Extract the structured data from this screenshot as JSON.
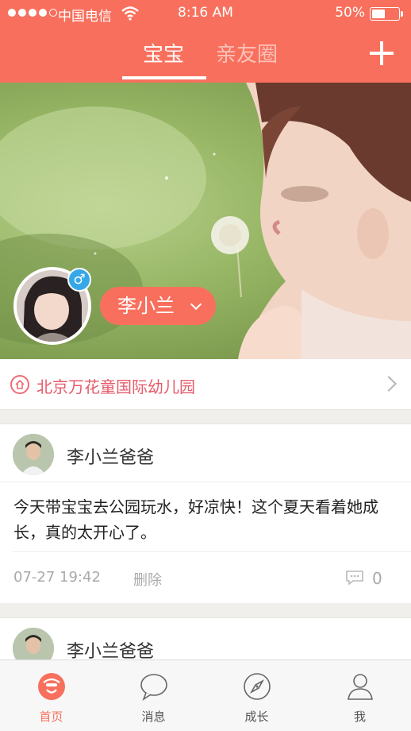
{
  "status_bar": {
    "carrier": "中国电信",
    "time": "8:16 AM",
    "battery": "50%",
    "battery_level": 0.5
  },
  "header": {
    "tabs": [
      {
        "label": "宝宝",
        "active": true
      },
      {
        "label": "亲友圈",
        "active": false
      }
    ],
    "add_icon": "plus-icon"
  },
  "profile": {
    "gender_symbol": "♂",
    "name": "李小兰",
    "school": "北京万花童国际幼儿园"
  },
  "posts": [
    {
      "author": "李小兰爸爸",
      "text": "今天带宝宝去公园玩水，好凉快！这个夏天看着她成长，真的太开心了。",
      "time": "07-27 19:42",
      "delete_label": "删除",
      "comment_count": "0"
    },
    {
      "author": "李小兰爸爸"
    }
  ],
  "tabbar": [
    {
      "label": "首页",
      "icon": "home-face-icon",
      "active": true
    },
    {
      "label": "消息",
      "icon": "message-bubble-icon",
      "active": false
    },
    {
      "label": "成长",
      "icon": "compass-icon",
      "active": false
    },
    {
      "label": "我",
      "icon": "person-icon",
      "active": false
    }
  ],
  "colors": {
    "brand": "#f8705d",
    "gender_badge": "#36a8e8",
    "school_text": "#e65a6a"
  }
}
